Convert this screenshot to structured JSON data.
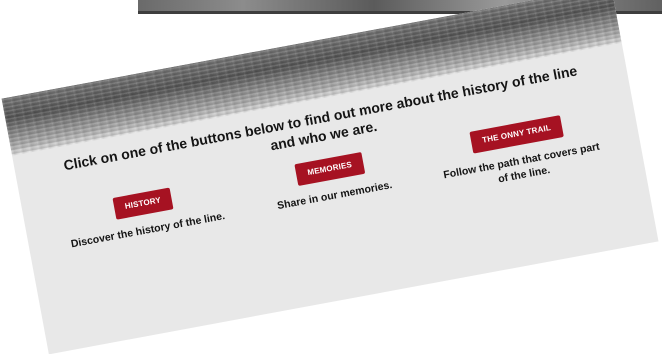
{
  "heading": "Click on one of the buttons below to find out more about the history of the line and who we are.",
  "sections": [
    {
      "button_label": "HISTORY",
      "description": "Discover the history of the line."
    },
    {
      "button_label": "MEMORIES",
      "description": "Share in our memories."
    },
    {
      "button_label": "THE ONNY TRAIL",
      "description": "Follow the path that covers part of the line."
    }
  ],
  "colors": {
    "button_bg": "#a61222",
    "card_bg": "#e8e8e8",
    "text": "#141414"
  }
}
